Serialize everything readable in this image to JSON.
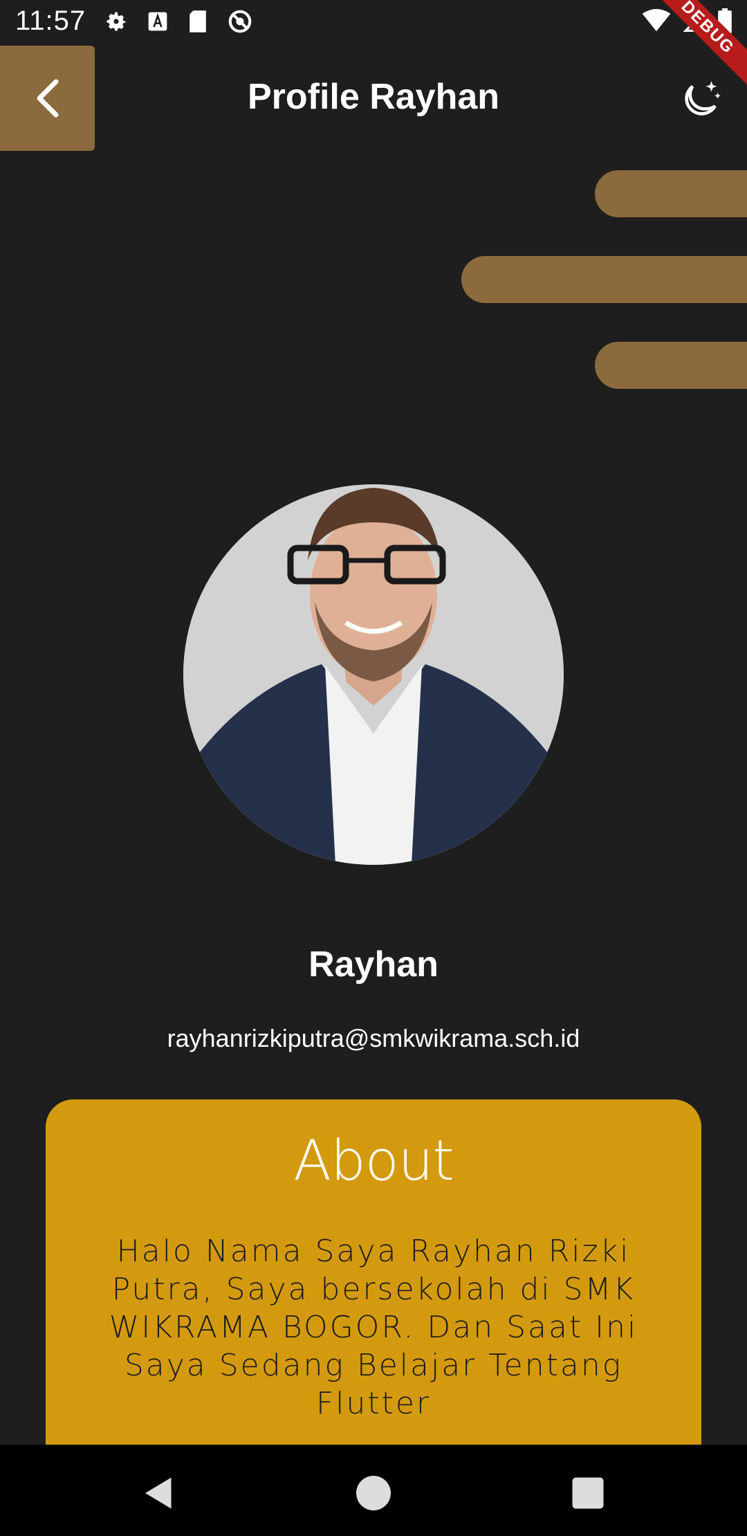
{
  "status_bar": {
    "time": "11:57"
  },
  "debug_banner": "DEBUG",
  "app_bar": {
    "title": "Profile Rayhan"
  },
  "profile": {
    "name": "Rayhan",
    "email": "rayhanrizkiputra@smkwikrama.sch.id"
  },
  "about": {
    "title": "About",
    "text": "Halo Nama Saya Rayhan Rizki Putra, Saya bersekolah di SMK WIKRAMA BOGOR. Dan Saat Ini Saya Sedang Belajar Tentang Flutter"
  },
  "colors": {
    "background": "#1e1e1e",
    "accent_brown": "#8b6a3d",
    "about_card": "#d49a0f",
    "debug_red": "#b71c1c"
  },
  "icons": {
    "back": "chevron-left-icon",
    "theme": "moon-stars-icon",
    "nav_back": "triangle-back-icon",
    "nav_home": "circle-home-icon",
    "nav_recents": "square-recents-icon"
  }
}
